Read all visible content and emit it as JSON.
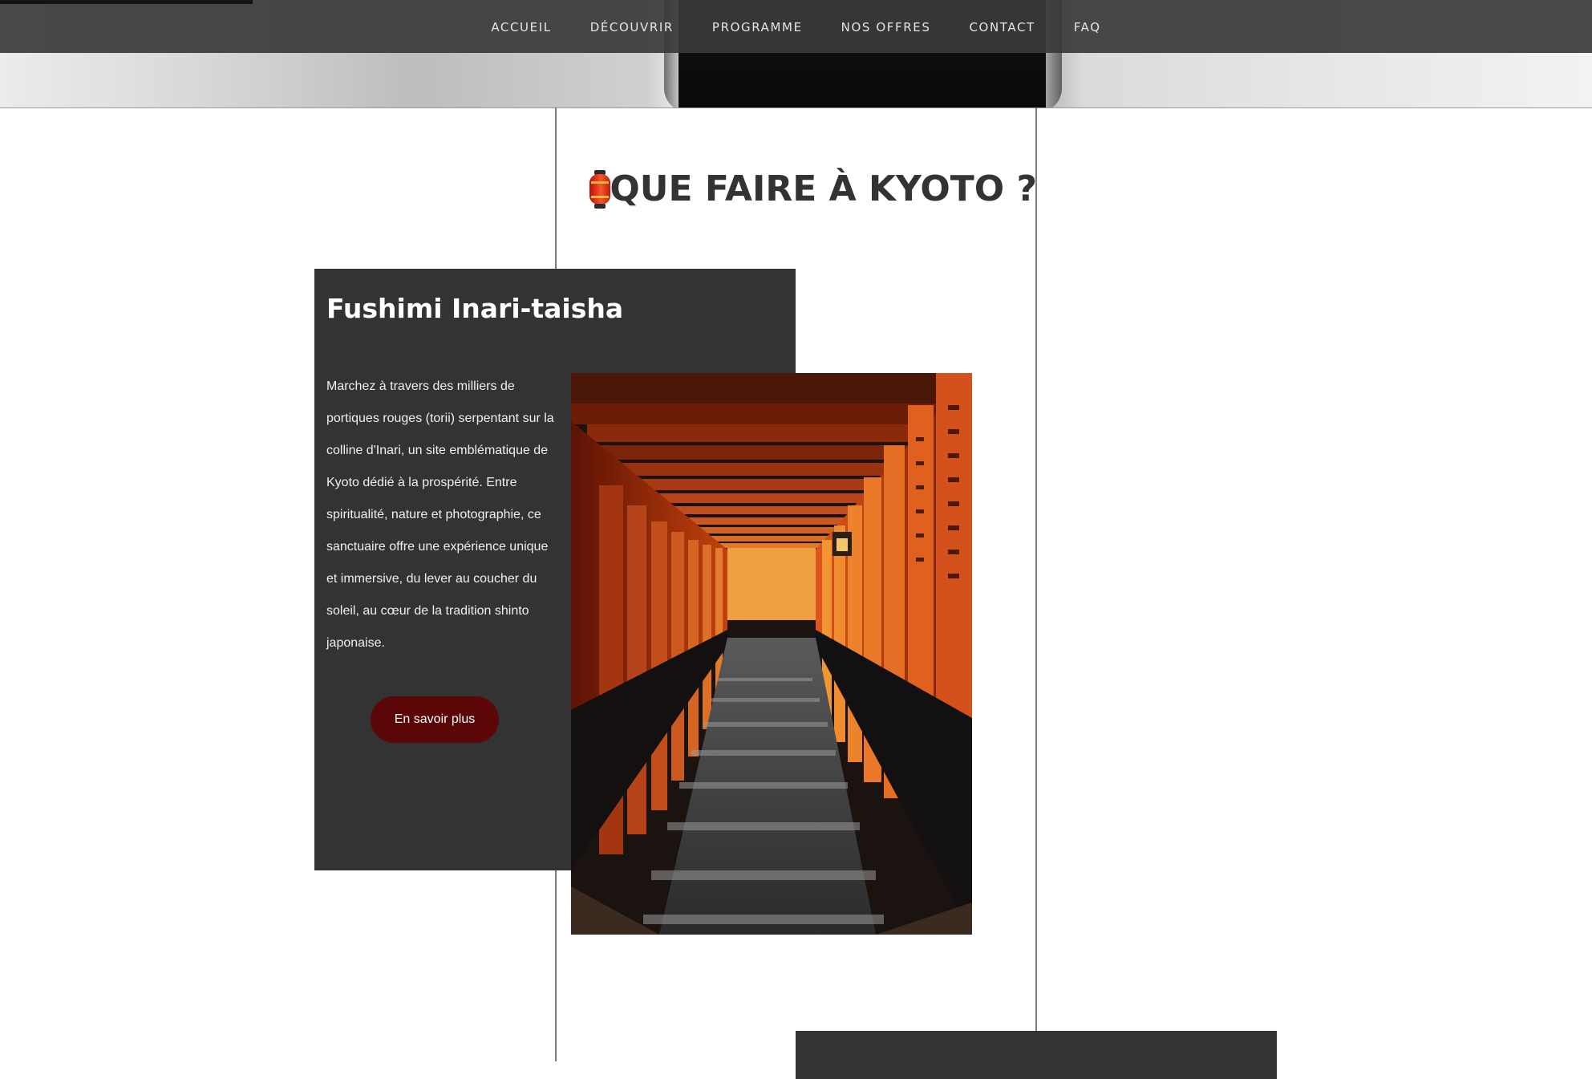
{
  "nav": {
    "items": [
      "ACCUEIL",
      "DÉCOUVRIR",
      "PROGRAMME",
      "NOS OFFRES",
      "CONTACT",
      "FAQ"
    ]
  },
  "section": {
    "icon": "red-lantern-icon",
    "title": "QUE FAIRE À KYOTO ?"
  },
  "card": {
    "title": "Fushimi Inari-taisha",
    "text": "Marchez à travers des milliers de portiques rouges (torii) serpentant sur la colline d'Inari, un site emblématique de Kyoto dédié à la prospérité. Entre spiritualité, nature et photographie, ce sanctuaire offre une expérience unique et immersive, du lever au coucher du soleil, au cœur de la tradition shinto japonaise.",
    "button": "En savoir plus",
    "image": "torii-gates-tunnel-photo"
  },
  "colors": {
    "nav_bg": "#3a3a3a",
    "card_bg": "#333333",
    "button_bg": "#5c0707",
    "title": "#333333"
  }
}
